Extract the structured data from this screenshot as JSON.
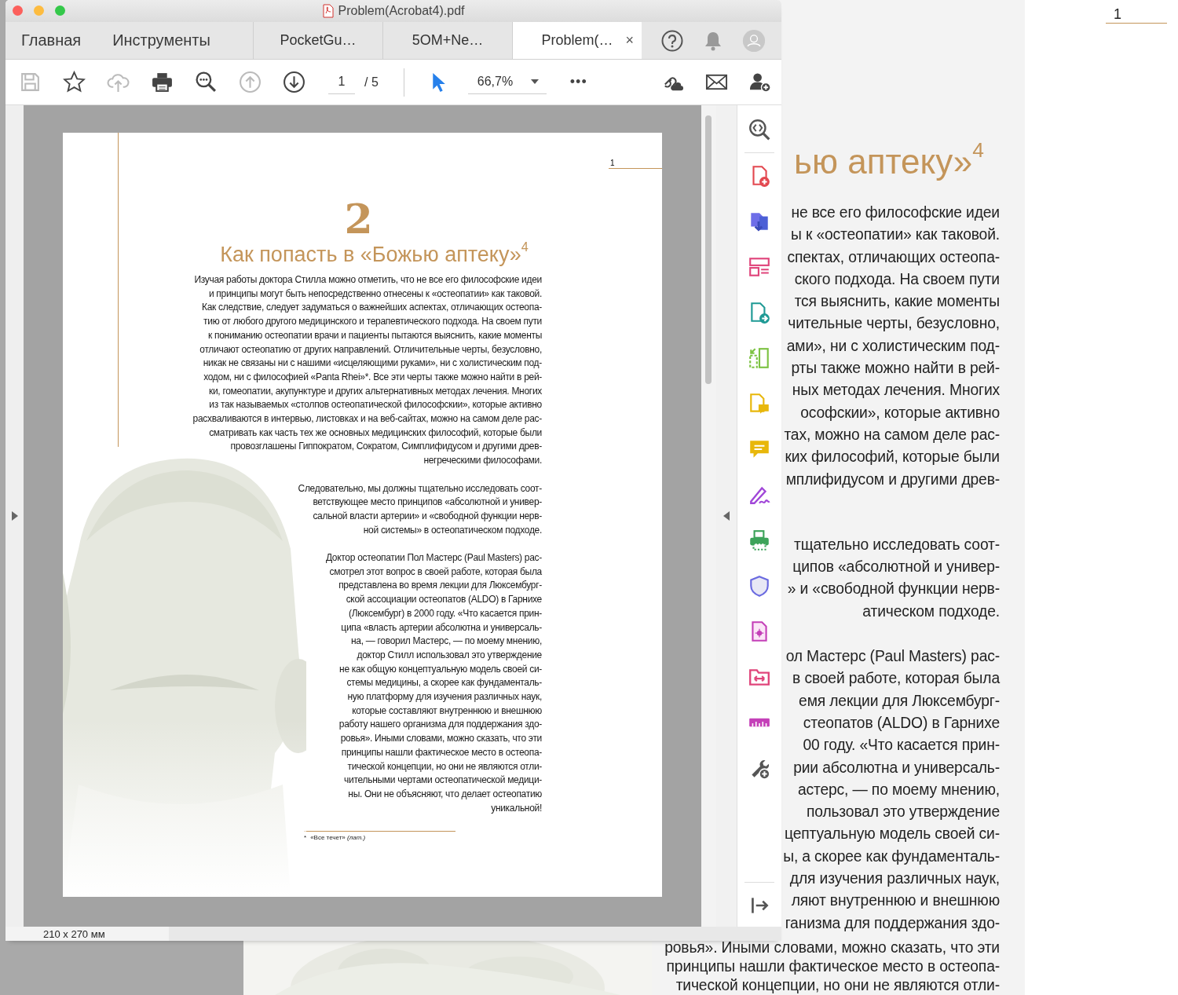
{
  "window": {
    "title": "Problem(Acrobat4).pdf"
  },
  "nav_tabs": [
    {
      "label": "Главная",
      "selected": false
    },
    {
      "label": "Инструменты",
      "selected": false
    }
  ],
  "doc_tabs": [
    {
      "label": "PocketGu…",
      "selected": false
    },
    {
      "label": "5OM+Ne…",
      "selected": false
    },
    {
      "label": "Problem(…",
      "selected": true,
      "close": "×"
    }
  ],
  "toolbar": {
    "page": "1",
    "page_total": "/ 5",
    "zoom": "66,7%",
    "more": "•••"
  },
  "page": {
    "page_number": "1",
    "chapter": "2",
    "title": "Как попасть в «Божью аптеку»$^{4}$",
    "paragraphs": [
      {
        "lines": [
          "Изучая работы доктора Стилла можно отметить, что не все его философские идеи",
          "и принципы могут быть непосредственно отнесены к «остеопатии» как таковой.",
          "Как следствие, следует задуматься о важнейших аспектах, отличающих остеопа-",
          "тию от любого другого медицинского и терапевтического подхода. На своем пути",
          "к пониманию остеопатии врачи и пациенты пытаются выяснить, какие моменты",
          "отличают остеопатию от других направлений. Отличительные черты, безусловно,",
          "никак не связаны ни с нашими «исцеляющими руками», ни с холистическим под-",
          "ходом, ни с философией «Panta Rhei»*. Все эти черты также можно найти в рей-",
          "ки, гомеопатии, акупунктуре и других альтернативных методах лечения. Многих",
          "из так называемых «столпов остеопатической философскии», которые активно",
          "расхваливаются в интервью, листовках и на веб-сайтах, можно на самом деле рас-",
          "сматривать как часть тех же основных медицинских философий, которые были",
          "провозглашены Гиппократом, Сократом, Симплифидусом и другими древ-",
          "негреческими философами."
        ]
      },
      {
        "lines": [
          "Следовательно, мы должны тщательно исследовать соот-",
          "ветствующее место принципов «абсолютной и универ-",
          "сальной власти артерии» и «свободной функции нерв-",
          "ной системы» в остеопатическом подходе."
        ]
      },
      {
        "lines": [
          "Доктор остеопатии Пол Мастерс (Paul Masters) рас-",
          "смотрел этот вопрос в своей работе, которая была",
          "представлена во время лекции для Люксембург-",
          "ской ассоциации остеопатов (ALDO) в Гарнихе",
          "(Люксембург) в 2000 году. «Что касается прин-",
          "ципа «власть артерии абсолютна и универсаль-",
          "на, — говорил Мастерс, — по моему мнению,",
          "доктор Стилл использовал это утверждение",
          "не как общую концептуальную модель своей си-",
          "стемы медицины, а скорее как фундаменталь-",
          "ную платформу для изучения различных наук,",
          "которые составляют внутреннюю и внешнюю",
          "работу нашего организма для поддержания здо-",
          "ровья». Иными словами, можно сказать, что эти",
          "принципы нашли фактическое место в остеопа-",
          "тической концепции, но они не являются отли-",
          "чительными чертами остеопатической медици-",
          "ны. Они не объясняют, что делает остеопатию",
          "уникальной!"
        ]
      }
    ],
    "footnote": {
      "mark": "*",
      "text": "«Все течет» *(лат.)*"
    }
  },
  "status_bar": {
    "page_size": "210 x 270 мм"
  },
  "background_document": {
    "title": "ью аптеку»$^{4}$",
    "page_number": "1",
    "blocks": [
      {
        "lines": [
          "не все его философские идеи",
          "ы к «остеопатии» как таковой.",
          "спектах, отличающих остеопа-",
          "ского подхода. На своем пути",
          "тся выяснить, какие моменты",
          "чительные черты, безусловно,",
          "ами», ни с холистическим под-",
          "рты также можно найти в рей-",
          "ных методах лечения. Многих",
          "ософскии», которые активно",
          "тах, можно на самом деле рас-",
          "ких философий, которые были",
          "мплифидусом и другими древ-"
        ]
      },
      {
        "lines": [
          "тщательно исследовать соот-",
          "ципов «абсолютной и универ-",
          "» и «свободной функции нерв-",
          "атическом подходе."
        ]
      },
      {
        "lines": [
          "ол Мастерс (Paul Masters) рас-",
          "в своей работе, которая была",
          "емя лекции для Люксембург-",
          "стеопатов (ALDO) в Гарнихе",
          "00 году. «Что касается прин-",
          "рии абсолютна и универсаль-",
          "астерс, — по моему мнению,",
          "пользовал это утверждение",
          "цептуальную модель своей си-",
          "ы, а скорее как фундаменталь-",
          "для изучения различных наук,",
          "ляют внутреннюю и внешнюю",
          "ганизма для поддержания здо-"
        ]
      },
      {
        "lines": [
          "ровья». Иными словами, можно сказать, что эти",
          "принципы нашли фактическое место в остеопа-",
          "тической концепции, но они не являются отли-"
        ]
      }
    ]
  }
}
